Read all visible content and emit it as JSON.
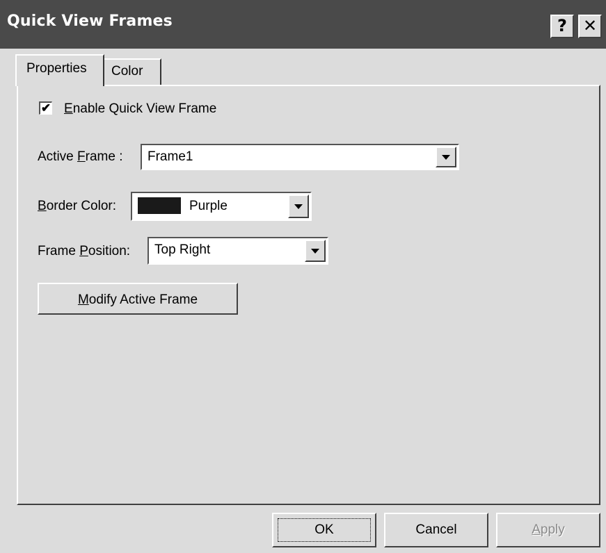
{
  "window": {
    "title": "Quick View Frames",
    "help_label": "?",
    "close_label": "✕"
  },
  "tabs": [
    {
      "label": "Properties",
      "active": true
    },
    {
      "label": "Color",
      "active": false
    }
  ],
  "properties": {
    "enable_checkbox": {
      "mnemonic": "E",
      "rest": "nable Quick View Frame",
      "checked": true,
      "check_mark": "✔"
    },
    "active_frame": {
      "label_pre": "Active ",
      "mnemonic": "F",
      "label_post": "rame :",
      "value": "Frame1"
    },
    "border_color": {
      "mnemonic": "B",
      "label_post": "order Color:",
      "value": "Purple",
      "swatch_color": "#1a1a1a"
    },
    "frame_position": {
      "label_pre": "Frame ",
      "mnemonic": "P",
      "label_post": "osition:",
      "value": "Top Right"
    },
    "modify_button": {
      "mnemonic": "M",
      "rest": "odify Active Frame"
    }
  },
  "footer": {
    "ok_label": "OK",
    "cancel_label": "Cancel",
    "apply_mnemonic": "A",
    "apply_rest": "pply"
  }
}
